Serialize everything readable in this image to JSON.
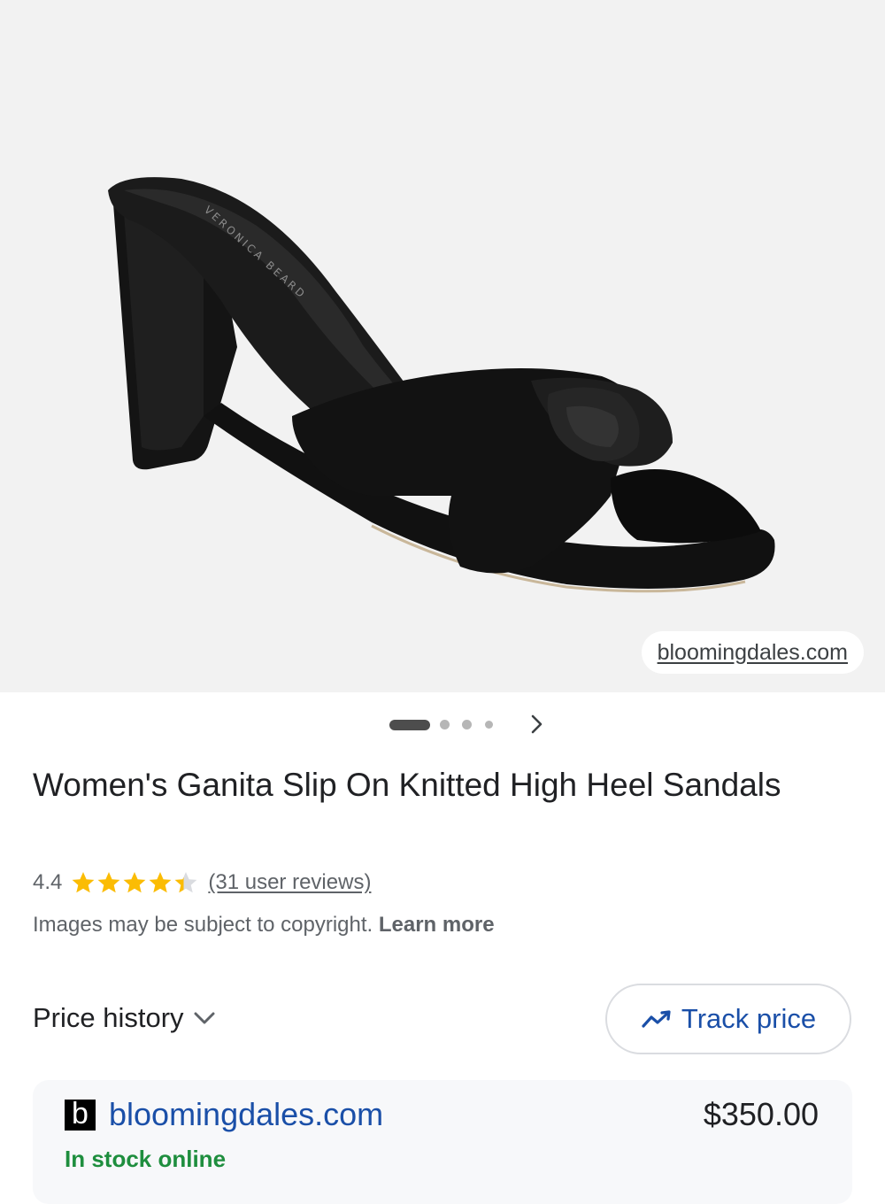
{
  "image": {
    "alt": "black leather knotted high heel slide sandal",
    "source": "bloomingdales.com",
    "carousel": {
      "count": 4,
      "active_index": 0
    },
    "next_icon": "chevron-right-icon"
  },
  "product": {
    "title": "Women's Ganita Slip On Knitted High Heel Sandals",
    "rating": "4.4",
    "rating_value": 4.4,
    "rating_max": 5,
    "reviews": "(31 user reviews)",
    "star_color": "#fbbc04"
  },
  "copyright": {
    "text": "Images may be subject to copyright.",
    "learn_more": "Learn more"
  },
  "price_history": {
    "label": "Price history",
    "icon": "chevron-down-icon"
  },
  "track_price": {
    "label": "Track price",
    "icon": "trending-line-icon"
  },
  "merchant": {
    "logo_letter": "b",
    "name": "bloomingdales.com",
    "price": "$350.00",
    "stock": "In stock online"
  },
  "colors": {
    "link_blue": "#1a4fa8",
    "stock_green": "#1e8e3e",
    "image_bg": "#f2f2f2"
  }
}
